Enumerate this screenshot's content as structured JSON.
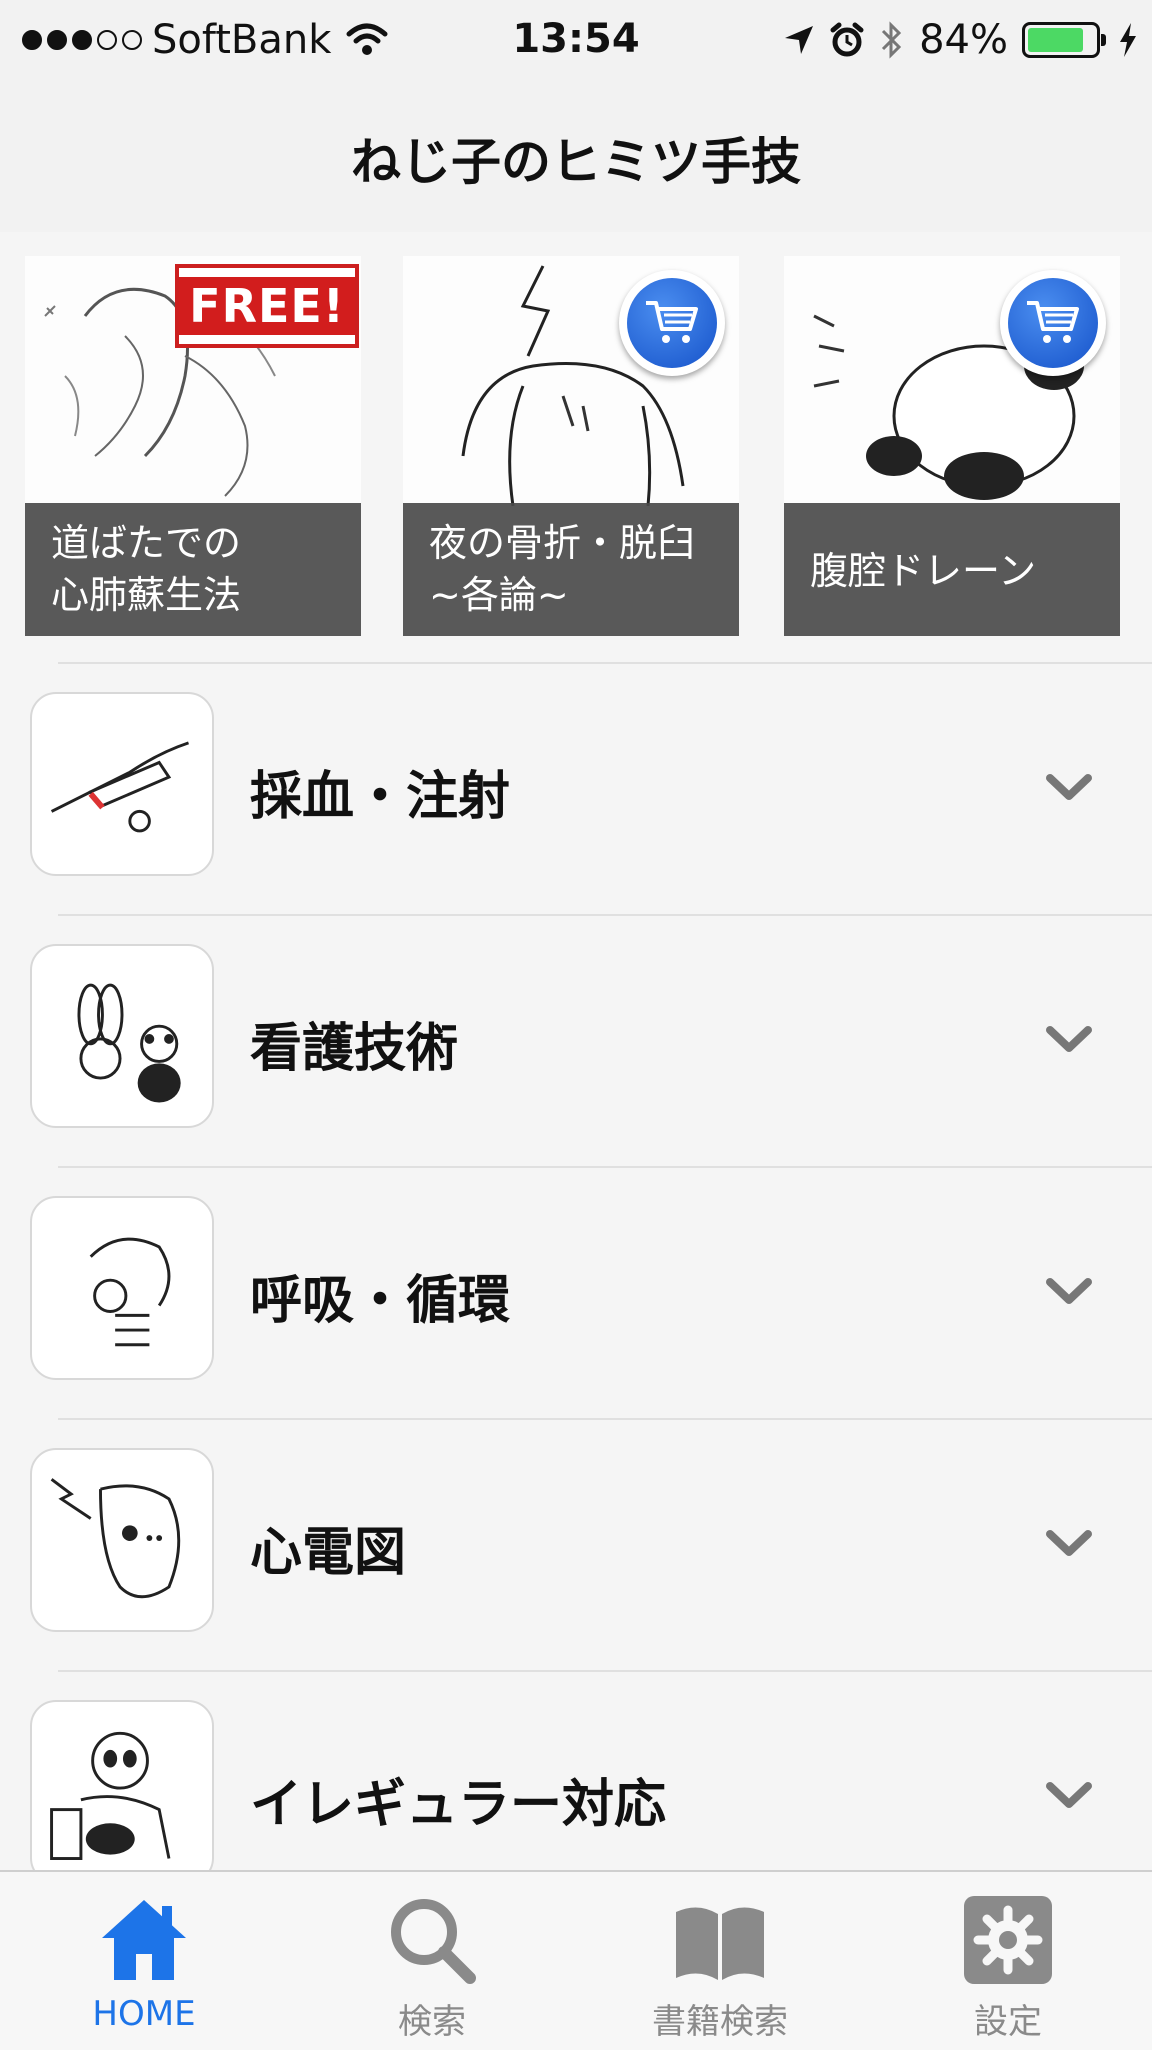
{
  "status_bar": {
    "carrier": "SoftBank",
    "time": "13:54",
    "battery": "84%",
    "battery_level": 0.84,
    "icons": [
      "signal-dots-icon",
      "wifi-icon",
      "location-arrow-icon",
      "alarm-icon",
      "bluetooth-icon",
      "battery-icon",
      "charging-bolt-icon"
    ]
  },
  "nav": {
    "title": "ねじ子のヒミツ手技"
  },
  "featured": [
    {
      "caption": "道ばたでの\n心肺蘇生法",
      "badge": "FREE!"
    },
    {
      "caption": "夜の骨折・脱臼\n~各論~",
      "badge": "cart-icon"
    },
    {
      "caption": "腹腔ドレーン",
      "badge": "cart-icon"
    }
  ],
  "categories": [
    {
      "label": "採血・注射"
    },
    {
      "label": "看護技術"
    },
    {
      "label": "呼吸・循環"
    },
    {
      "label": "心電図"
    },
    {
      "label": "イレギュラー対応"
    }
  ],
  "tabs": [
    {
      "label": "HOME",
      "icon": "home-icon",
      "active": true
    },
    {
      "label": "検索",
      "icon": "search-icon",
      "active": false
    },
    {
      "label": "書籍検索",
      "icon": "book-icon",
      "active": false
    },
    {
      "label": "設定",
      "icon": "gear-icon",
      "active": false
    }
  ],
  "colors": {
    "accent": "#1d74e8",
    "inactive": "#8a8a8a",
    "free_red": "#d21d1d",
    "cart_blue": "#1552c9"
  }
}
